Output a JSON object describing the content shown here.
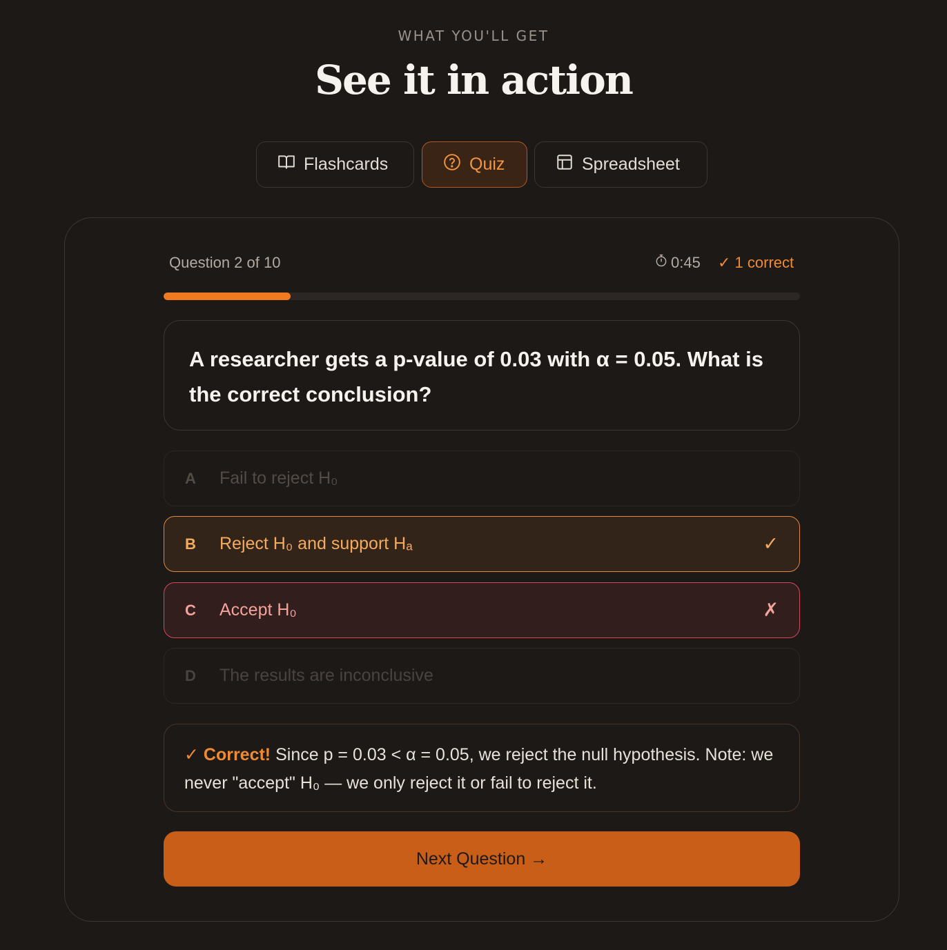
{
  "section": {
    "eyebrow": "WHAT YOU'LL GET",
    "title": "See it in action"
  },
  "tabs": [
    {
      "label": "Flashcards",
      "icon": "book-icon",
      "active": false
    },
    {
      "label": "Quiz",
      "icon": "question-circle-icon",
      "active": true
    },
    {
      "label": "Spreadsheet",
      "icon": "table-icon",
      "active": false
    }
  ],
  "quiz": {
    "question_counter": "Question 2 of 10",
    "timer": "0:45",
    "score": "✓ 1 correct",
    "progress": 0.2,
    "question": "A researcher gets a p-value of 0.03 with α = 0.05. What is the correct conclusion?",
    "options": [
      {
        "letter": "A",
        "text": "Fail to reject H₀",
        "state": "dimmed",
        "mark": ""
      },
      {
        "letter": "B",
        "text": "Reject H₀ and support Hₐ",
        "state": "correct",
        "mark": "✓"
      },
      {
        "letter": "C",
        "text": "Accept H₀",
        "state": "wrong",
        "mark": "✗"
      },
      {
        "letter": "D",
        "text": "The results are inconclusive",
        "state": "dimmed",
        "mark": ""
      }
    ],
    "feedback": {
      "label": "✓ Correct!",
      "text": " Since p = 0.03 < α = 0.05, we reject the null hypothesis. Note: we never \"accept\" H₀ — we only reject it or fail to reject it."
    },
    "next_button": "Next Question →"
  },
  "colors": {
    "background": "#1d1917",
    "accent": "#f07a1f",
    "correct": "#f5ab5f",
    "wrong": "#d6495a"
  }
}
